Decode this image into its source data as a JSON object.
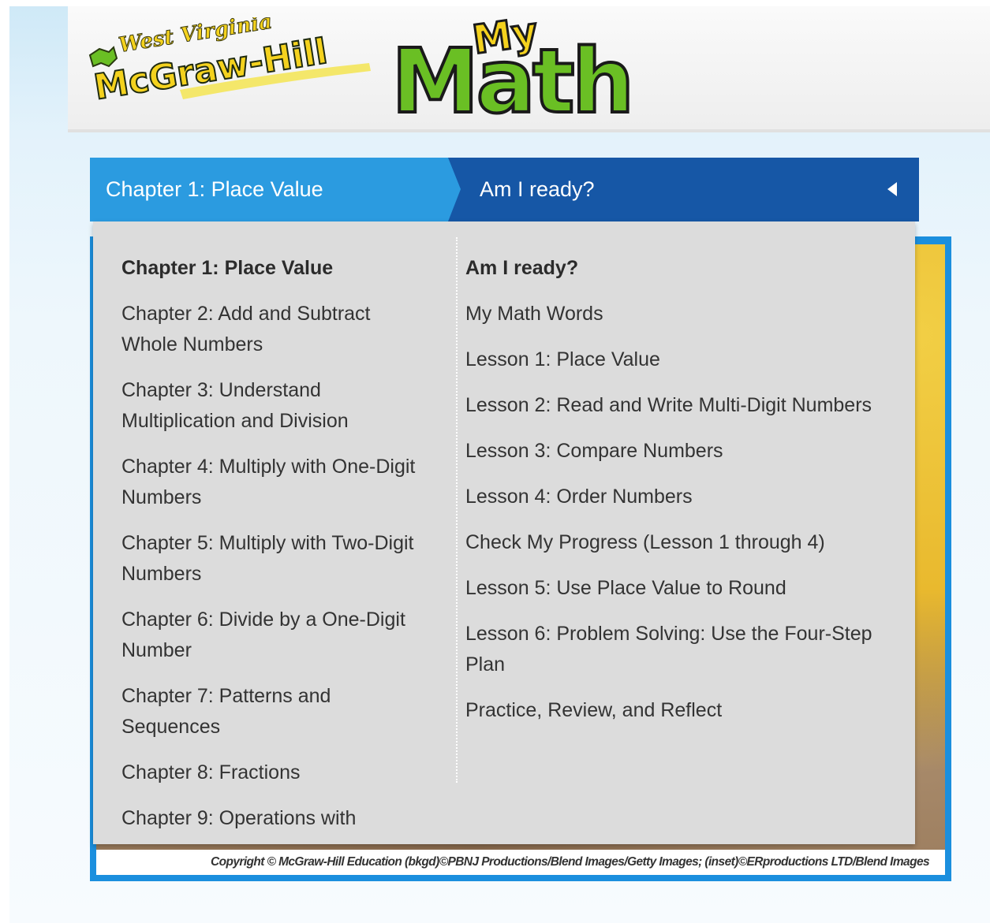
{
  "header": {
    "brand_state": "West Virginia",
    "brand_name": "McGraw-Hill",
    "product_my": "My",
    "product_math": "Math"
  },
  "nav": {
    "chapter_label": "Chapter 1: Place Value",
    "lesson_label": "Am I ready?",
    "arrow_icon": "caret-left-icon"
  },
  "chapters": [
    {
      "label": "Chapter 1: Place Value",
      "active": true
    },
    {
      "label": "Chapter 2: Add and Subtract Whole Numbers",
      "active": false
    },
    {
      "label": "Chapter 3: Understand Multiplication and Division",
      "active": false
    },
    {
      "label": "Chapter 4: Multiply with One-Digit Numbers",
      "active": false
    },
    {
      "label": "Chapter 5: Multiply with Two-Digit Numbers",
      "active": false
    },
    {
      "label": "Chapter 6: Divide by a One-Digit Number",
      "active": false
    },
    {
      "label": "Chapter 7: Patterns and Sequences",
      "active": false
    },
    {
      "label": "Chapter 8: Fractions",
      "active": false
    },
    {
      "label": "Chapter 9: Operations with",
      "active": false
    }
  ],
  "lessons": [
    {
      "label": "Am I ready?",
      "active": true
    },
    {
      "label": "My Math Words",
      "active": false
    },
    {
      "label": "Lesson 1: Place Value",
      "active": false
    },
    {
      "label": "Lesson 2: Read and Write Multi-Digit Numbers",
      "active": false
    },
    {
      "label": "Lesson 3: Compare Numbers",
      "active": false
    },
    {
      "label": "Lesson 4: Order Numbers",
      "active": false
    },
    {
      "label": "Check My Progress (Lesson 1 through 4)",
      "active": false
    },
    {
      "label": "Lesson 5: Use Place Value to Round",
      "active": false
    },
    {
      "label": "Lesson 6: Problem Solving: Use the Four-Step Plan",
      "active": false
    },
    {
      "label": "Practice, Review, and Reflect",
      "active": false
    }
  ],
  "copyright": "Copyright © McGraw-Hill Education (bkgd)©PBNJ Productions/Blend Images/Getty Images; (inset)©ERproductions LTD/Blend Images",
  "colors": {
    "nav_dark_blue": "#1657a6",
    "nav_light_blue": "#2b9be0",
    "dropdown_bg": "#dcdcdc",
    "logo_green": "#6abf24",
    "logo_yellow": "#f4d21e"
  }
}
